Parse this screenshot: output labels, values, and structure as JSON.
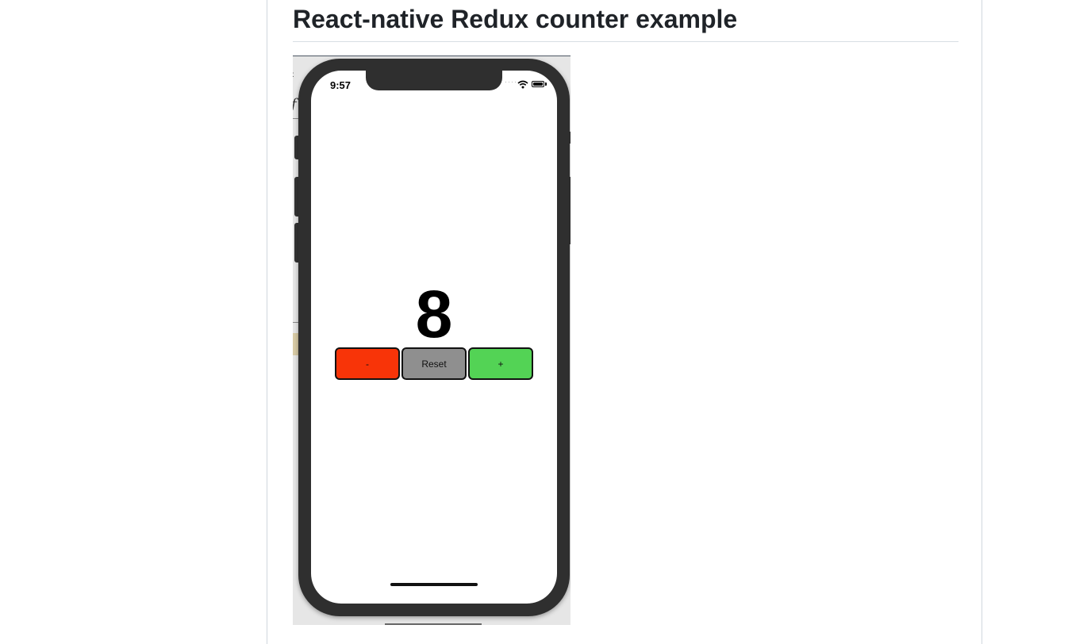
{
  "article": {
    "heading": "React-native Redux counter example"
  },
  "phone": {
    "status_bar": {
      "time": "9:57",
      "icons": [
        "signal-dots-icon",
        "wifi-icon",
        "battery-icon"
      ]
    },
    "counter": {
      "value": "8"
    },
    "buttons": {
      "decrement_label": "-",
      "reset_label": "Reset",
      "increment_label": "+"
    },
    "colors": {
      "decrement": "#f83408",
      "reset": "#8f8f8f",
      "increment": "#53d355",
      "device_frame": "#2f2f2f"
    }
  }
}
